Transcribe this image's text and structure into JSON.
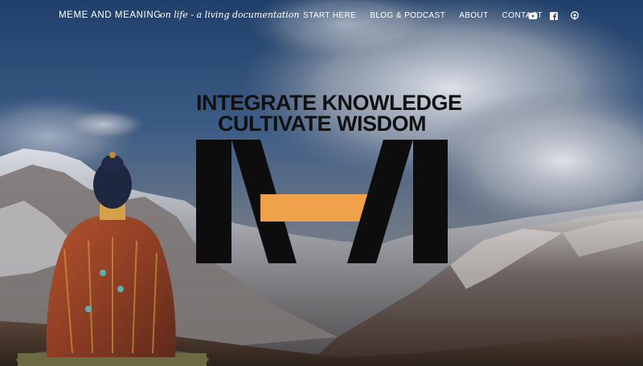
{
  "header": {
    "brand": "MEME AND MEANING",
    "tagline": "on life - a living documentation",
    "nav": [
      {
        "label": "START HERE"
      },
      {
        "label": "BLOG & PODCAST"
      },
      {
        "label": "ABOUT"
      },
      {
        "label": "CONTACT"
      }
    ],
    "social_icons": [
      "youtube-icon",
      "facebook-icon",
      "podcast-icon"
    ]
  },
  "hero": {
    "line1": "INTEGRATE KNOWLEDGE",
    "line2": "CULTIVATE WISDOM",
    "logo_accent_color": "#f0a24a",
    "logo_color": "#0d0d0d"
  }
}
